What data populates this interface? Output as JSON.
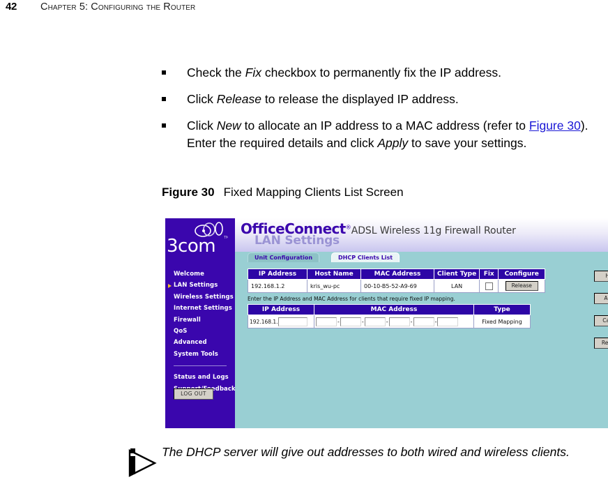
{
  "document": {
    "page_number": "42",
    "chapter_title": "Chapter 5: Configuring the Router"
  },
  "bullets": [
    {
      "segments": [
        {
          "text": "Check the ",
          "style": "normal"
        },
        {
          "text": "Fix",
          "style": "italic"
        },
        {
          "text": " checkbox to permanently fix the IP address.",
          "style": "normal"
        }
      ]
    },
    {
      "segments": [
        {
          "text": "Click ",
          "style": "normal"
        },
        {
          "text": "Release",
          "style": "italic"
        },
        {
          "text": " to release the displayed IP address.",
          "style": "normal"
        }
      ]
    },
    {
      "segments": [
        {
          "text": "Click ",
          "style": "normal"
        },
        {
          "text": "New",
          "style": "italic"
        },
        {
          "text": " to allocate an IP address to a MAC address (refer to ",
          "style": "normal"
        },
        {
          "text": "Figure 30",
          "style": "link"
        },
        {
          "text": "). Enter the required details and click ",
          "style": "normal"
        },
        {
          "text": "Apply",
          "style": "italic"
        },
        {
          "text": " to save your settings.",
          "style": "normal"
        }
      ]
    }
  ],
  "figure": {
    "label": "Figure 30",
    "caption": "Fixed Mapping Clients List Screen"
  },
  "screenshot": {
    "logo": {
      "wordmark": "3com",
      "mark_icon": "3com-loop-logo-icon"
    },
    "banner": {
      "brand_main": "OfficeConnect",
      "brand_registered": "®",
      "brand_sub": "ADSL Wireless 11g Firewall Router",
      "section_title": "LAN Settings"
    },
    "tabs": [
      {
        "label": "Unit Configuration",
        "active": false
      },
      {
        "label": "DHCP Clients List",
        "active": true
      }
    ],
    "nav": {
      "items": [
        {
          "label": "Welcome",
          "selected": false
        },
        {
          "label": "LAN Settings",
          "selected": true
        },
        {
          "label": "Wireless Settings",
          "selected": false
        },
        {
          "label": "Internet Settings",
          "selected": false
        },
        {
          "label": "Firewall",
          "selected": false
        },
        {
          "label": "QoS",
          "selected": false
        },
        {
          "label": "Advanced",
          "selected": false
        },
        {
          "label": "System Tools",
          "selected": false
        }
      ],
      "items_after_divider": [
        {
          "label": "Status and Logs",
          "selected": false
        },
        {
          "label": "Support/Feedback",
          "selected": false
        }
      ],
      "logout_label": "LOG OUT"
    },
    "clients_table": {
      "headers": [
        "IP Address",
        "Host Name",
        "MAC Address",
        "Client Type",
        "Fix",
        "Configure"
      ],
      "rows": [
        {
          "ip_address": "192.168.1.2",
          "host_name": "kris_wu-pc",
          "mac_address": "00-10-B5-52-A9-69",
          "client_type": "LAN",
          "fix_checked": false,
          "configure_label": "Release"
        }
      ]
    },
    "fixed_mapping": {
      "hint": "Enter the IP Address and MAC Address for clients that require fixed IP mapping.",
      "headers": [
        "IP Address",
        "MAC Address",
        "Type"
      ],
      "ip_prefix": "192.168.1.",
      "ip_suffix_value": "",
      "mac_octets": [
        "",
        "",
        "",
        "",
        "",
        ""
      ],
      "mac_separator": "-",
      "type_value": "Fixed Mapping"
    },
    "side_buttons": [
      {
        "label": "Help"
      },
      {
        "label": "Apply"
      },
      {
        "label": "Cancel"
      },
      {
        "label": "Refresh"
      }
    ]
  },
  "note": {
    "icon": "info-arrow-icon",
    "text": "The DHCP server will give out addresses to both wired and wireless clients."
  },
  "colors": {
    "nav_purple": "#3a06ad",
    "table_header_purple": "#2d06a6",
    "panel_teal": "#99cfd3",
    "link_blue": "#1b18d6",
    "section_title_lavender": "#9a93d4",
    "button_face": "#d4d0c8"
  }
}
